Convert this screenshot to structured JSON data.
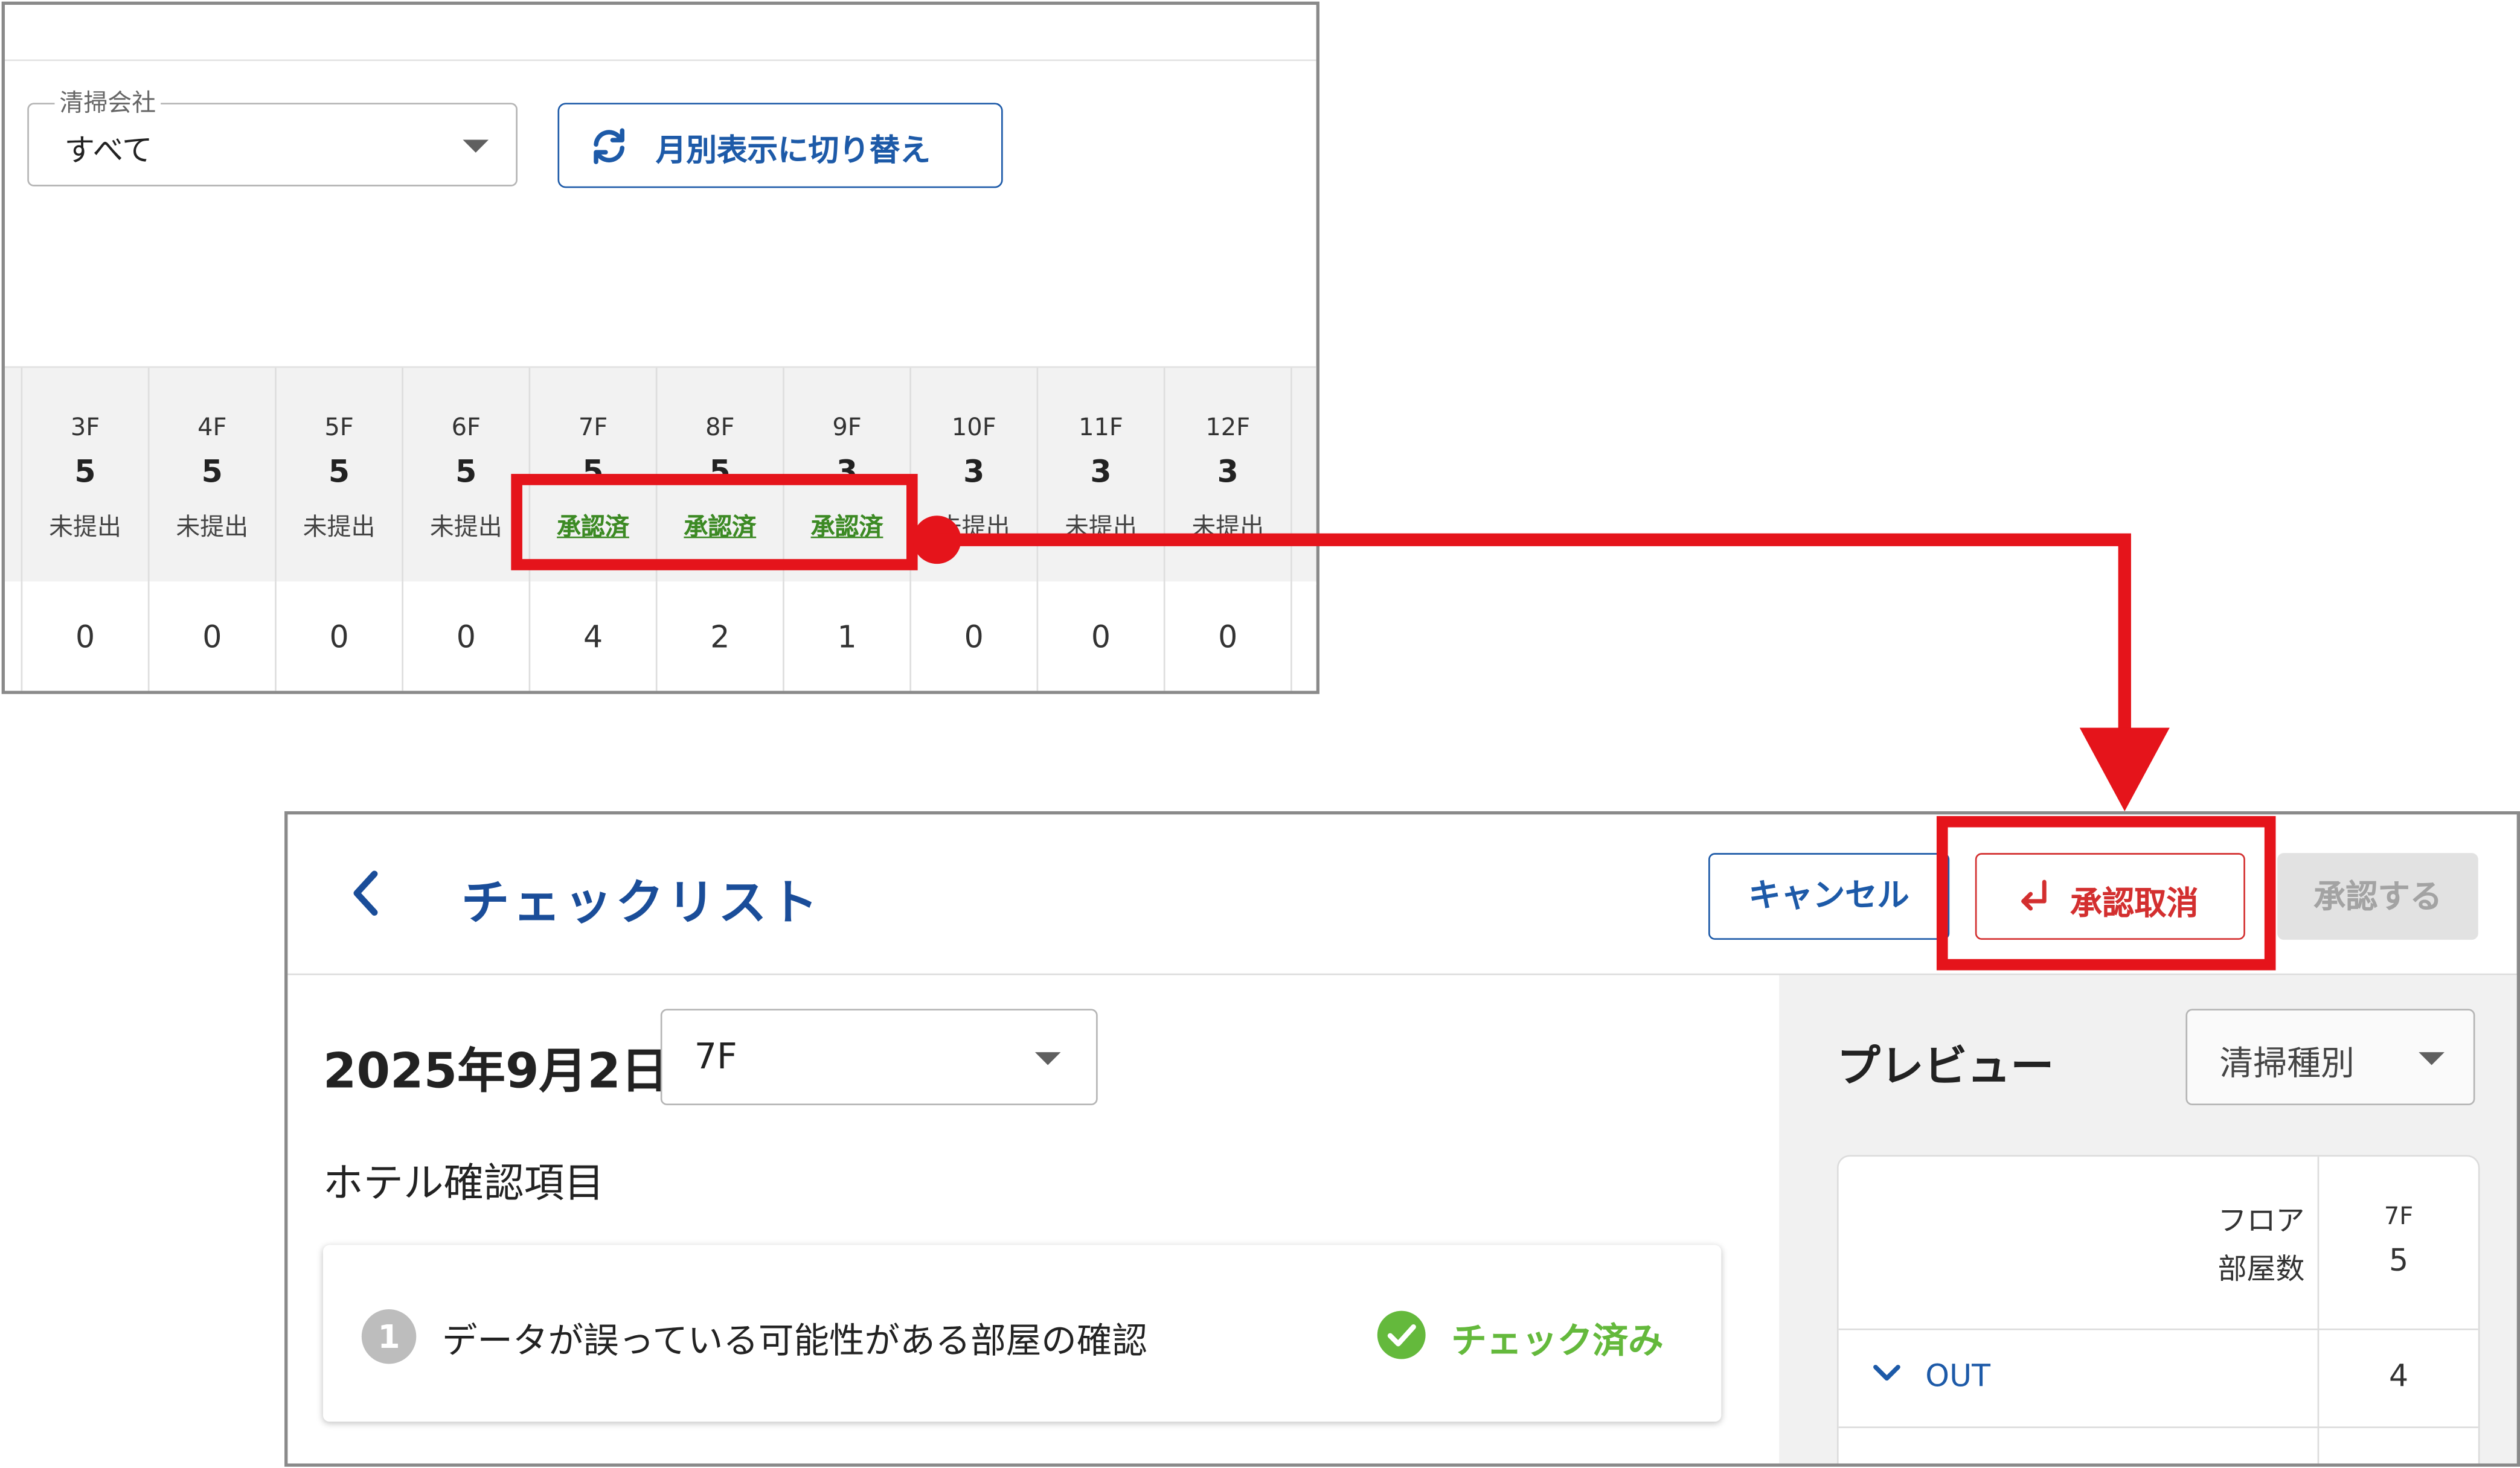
{
  "top_panel": {
    "company_filter": {
      "label": "清掃会社",
      "value": "すべて"
    },
    "switch_button_label": "月別表示に切り替え",
    "floors": [
      {
        "floor": "3F",
        "rooms": "5",
        "status": "未提出",
        "count": "0"
      },
      {
        "floor": "4F",
        "rooms": "5",
        "status": "未提出",
        "count": "0"
      },
      {
        "floor": "5F",
        "rooms": "5",
        "status": "未提出",
        "count": "0"
      },
      {
        "floor": "6F",
        "rooms": "5",
        "status": "未提出",
        "count": "0"
      },
      {
        "floor": "7F",
        "rooms": "5",
        "status": "承認済",
        "count": "4"
      },
      {
        "floor": "8F",
        "rooms": "5",
        "status": "承認済",
        "count": "2"
      },
      {
        "floor": "9F",
        "rooms": "3",
        "status": "承認済",
        "count": "1"
      },
      {
        "floor": "10F",
        "rooms": "3",
        "status": "未提出",
        "count": "0"
      },
      {
        "floor": "11F",
        "rooms": "3",
        "status": "未提出",
        "count": "0"
      },
      {
        "floor": "12F",
        "rooms": "3",
        "status": "未提出",
        "count": "0"
      }
    ]
  },
  "checklist": {
    "title": "チェックリスト",
    "cancel_label": "キャンセル",
    "revoke_label": "承認取消",
    "approve_label": "承認する",
    "date": "2025年9月2日",
    "floor_select": "7F",
    "section_title": "ホテル確認項目",
    "item": {
      "number": "1",
      "text": "データが誤っている可能性がある部屋の確認",
      "status": "チェック済み"
    },
    "preview": {
      "title": "プレビュー",
      "type_select": "清掃種別",
      "header_label_line1": "フロア",
      "header_label_line2": "部屋数",
      "floor": "7F",
      "room_count": "5",
      "row_label": "OUT",
      "row_value": "4"
    }
  },
  "colors": {
    "primary": "#1d5aa8",
    "title": "#1a4d99",
    "approved_green": "#3c8a24",
    "check_green": "#64b93c",
    "danger_red": "#d32f2f",
    "highlight_red": "#e5141b"
  },
  "icons": {
    "switch": "refresh-icon",
    "back": "chevron-left-icon",
    "revoke": "return-arrow-icon",
    "check": "check-circle-icon",
    "expand": "chevron-down-icon",
    "dropdown": "caret-down-icon"
  }
}
